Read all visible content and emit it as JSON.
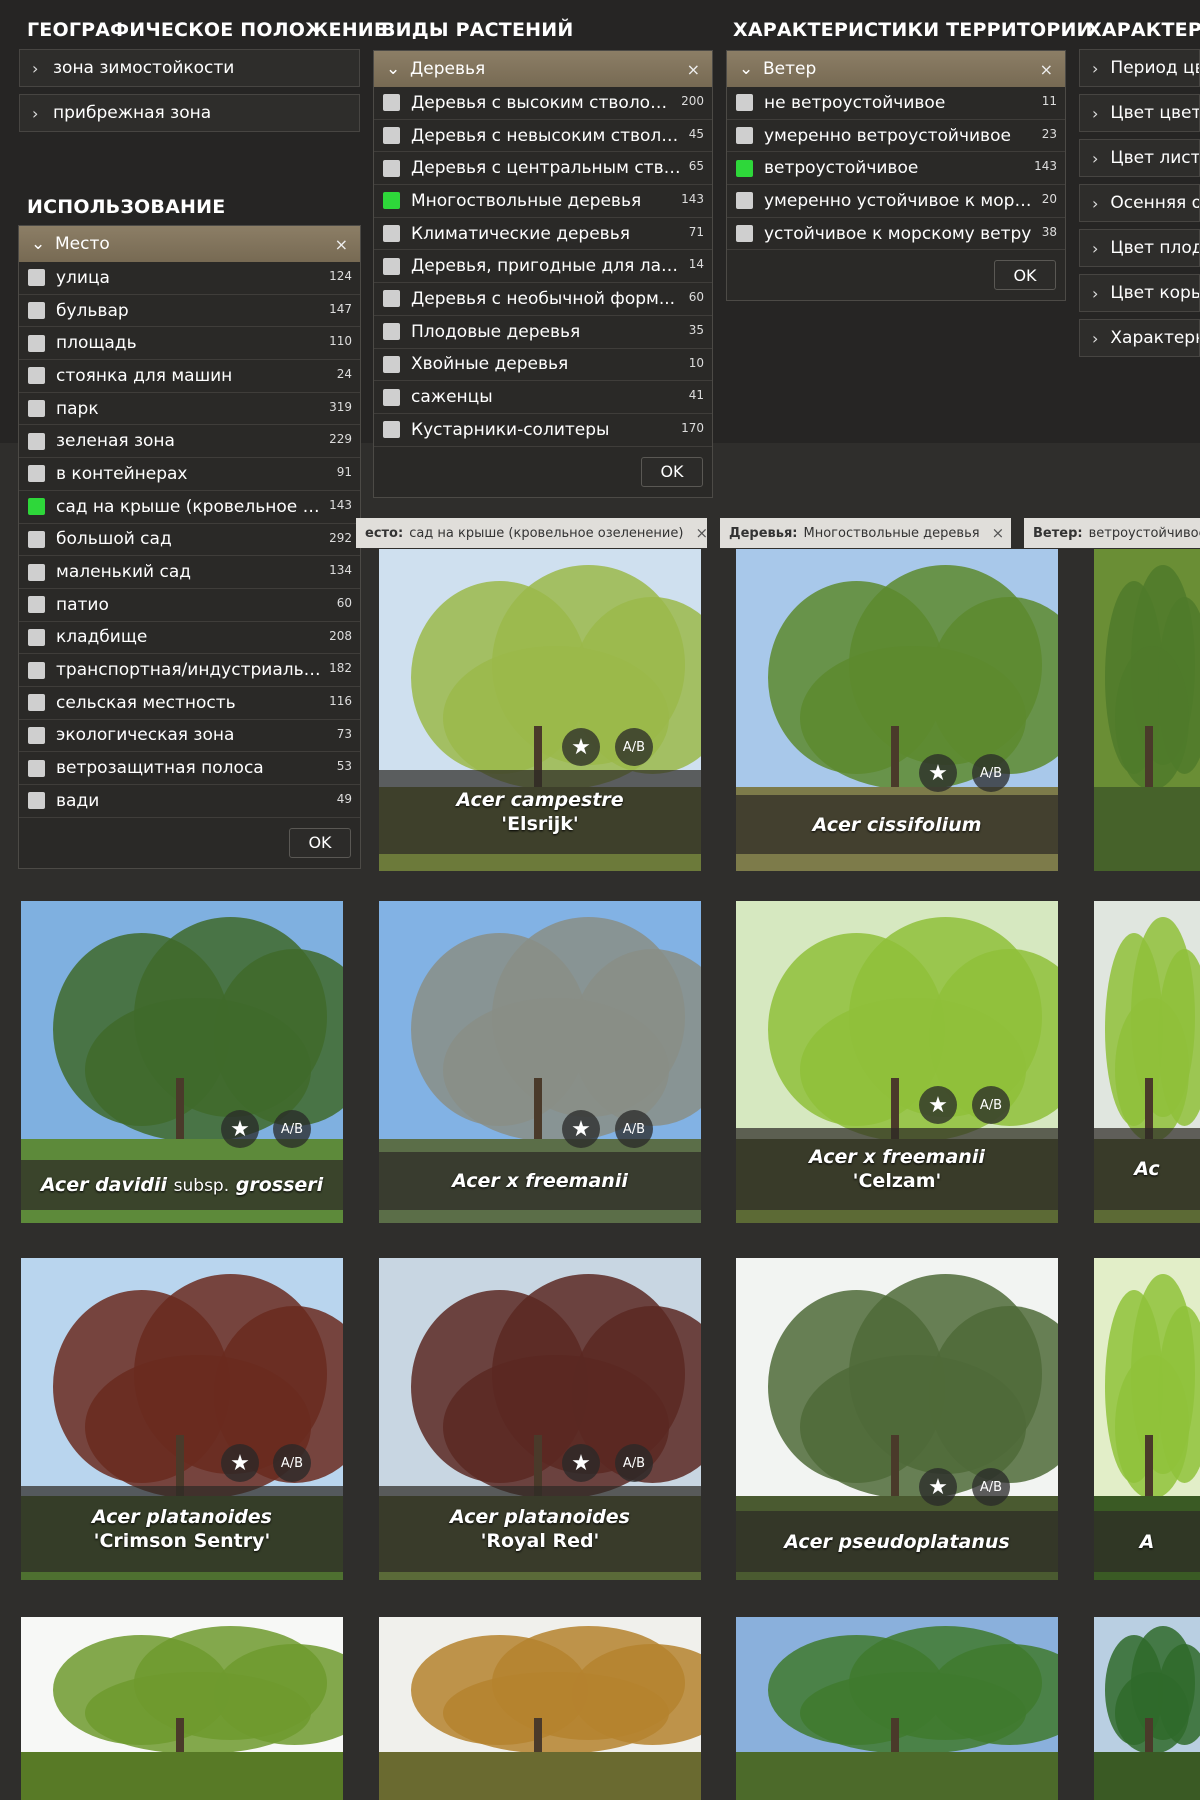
{
  "headings": {
    "geo": "ГЕОГРАФИЧЕСКОЕ ПОЛОЖЕНИЕ",
    "plants": "ВИДЫ РАСТЕНИЙ",
    "territory": "ХАРАКТЕРИСТИКИ ТЕРРИТОРИИ",
    "features": "ХАРАКТЕРИС",
    "usage": "ИСПОЛЬЗОВАНИЕ"
  },
  "geo_items": [
    "зона зимостойкости",
    "прибрежная зона"
  ],
  "feature_items": [
    "Период цв",
    "Цвет цвет",
    "Цвет лист",
    "Осенняя о",
    "Цвет плод",
    "Цвет коры",
    "Характерн"
  ],
  "place_panel": {
    "title": "Место",
    "ok": "OK",
    "rows": [
      {
        "label": "улица",
        "count": "124",
        "checked": false
      },
      {
        "label": "бульвар",
        "count": "147",
        "checked": false
      },
      {
        "label": "площадь",
        "count": "110",
        "checked": false
      },
      {
        "label": "стоянка для машин",
        "count": "24",
        "checked": false
      },
      {
        "label": "парк",
        "count": "319",
        "checked": false
      },
      {
        "label": "зеленая зона",
        "count": "229",
        "checked": false
      },
      {
        "label": "в контейнерах",
        "count": "91",
        "checked": false
      },
      {
        "label": "сад на крыше (кровельное о...",
        "count": "143",
        "checked": true
      },
      {
        "label": "большой сад",
        "count": "292",
        "checked": false
      },
      {
        "label": "маленький сад",
        "count": "134",
        "checked": false
      },
      {
        "label": "патио",
        "count": "60",
        "checked": false
      },
      {
        "label": "кладбище",
        "count": "208",
        "checked": false
      },
      {
        "label": "транспортная/индустриальн...",
        "count": "182",
        "checked": false
      },
      {
        "label": "сельская местность",
        "count": "116",
        "checked": false
      },
      {
        "label": "экологическая зона",
        "count": "73",
        "checked": false
      },
      {
        "label": "ветрозащитная полоса",
        "count": "53",
        "checked": false
      },
      {
        "label": "вади",
        "count": "49",
        "checked": false
      }
    ]
  },
  "trees_panel": {
    "title": "Деревья",
    "ok": "OK",
    "rows": [
      {
        "label": "Деревья с высоким стволом ...",
        "count": "200",
        "checked": false
      },
      {
        "label": "Деревья с невысоким стволо...",
        "count": "45",
        "checked": false
      },
      {
        "label": "Деревья с центральным ство...",
        "count": "65",
        "checked": false
      },
      {
        "label": "Многоствольные деревья",
        "count": "143",
        "checked": true
      },
      {
        "label": "Климатические деревья",
        "count": "71",
        "checked": false
      },
      {
        "label": "Деревья, пригодные для лаз...",
        "count": "14",
        "checked": false
      },
      {
        "label": "Деревья с необычной форм...",
        "count": "60",
        "checked": false
      },
      {
        "label": "Плодовые деревья",
        "count": "35",
        "checked": false
      },
      {
        "label": "Хвойные деревья",
        "count": "10",
        "checked": false
      },
      {
        "label": "саженцы",
        "count": "41",
        "checked": false
      },
      {
        "label": "Кустарники-солитеры",
        "count": "170",
        "checked": false
      }
    ]
  },
  "wind_panel": {
    "title": "Ветер",
    "ok": "OK",
    "rows": [
      {
        "label": "не ветроустойчивое",
        "count": "11",
        "checked": false
      },
      {
        "label": "умеренно ветроустойчивое",
        "count": "23",
        "checked": false
      },
      {
        "label": "ветроустойчивое",
        "count": "143",
        "checked": true
      },
      {
        "label": "умеренно устойчивое к морс...",
        "count": "20",
        "checked": false
      },
      {
        "label": "устойчивое к морскому ветру",
        "count": "38",
        "checked": false
      }
    ]
  },
  "chips": [
    {
      "key": "есто:",
      "value": "сад на крыше (кровельное озеленение)",
      "close": "×"
    },
    {
      "key": "Деревья:",
      "value": "Многоствольные деревья",
      "close": "×"
    },
    {
      "key": "Ветер:",
      "value": "ветроустойчивое",
      "close": ""
    }
  ],
  "cards": [
    {
      "genus": "Acer",
      "species": "campestre",
      "extra": "",
      "cultivar": "'Elsrijk'"
    },
    {
      "genus": "Acer",
      "species": "cissifolium",
      "extra": "",
      "cultivar": ""
    },
    {
      "genus": "",
      "species": "",
      "extra": "",
      "cultivar": ""
    },
    {
      "genus": "Acer",
      "species": "davidii",
      "extra": "subsp.",
      "cultivar": "grosseri"
    },
    {
      "genus": "Acer",
      "species": "x freemanii",
      "extra": "",
      "cultivar": ""
    },
    {
      "genus": "Acer",
      "species": "x freemanii",
      "extra": "",
      "cultivar": "'Celzam'"
    },
    {
      "genus": "Ac",
      "species": "",
      "extra": "",
      "cultivar": ""
    },
    {
      "genus": "Acer",
      "species": "platanoides",
      "extra": "",
      "cultivar": "'Crimson Sentry'"
    },
    {
      "genus": "Acer",
      "species": "platanoides",
      "extra": "",
      "cultivar": "'Royal Red'"
    },
    {
      "genus": "Acer",
      "species": "pseudoplatanus",
      "extra": "",
      "cultivar": ""
    },
    {
      "genus": "A",
      "species": "",
      "extra": "",
      "cultivar": ""
    }
  ],
  "icons": {
    "star": "star-icon",
    "ab": "compare-ab-icon",
    "chevron": "chevron-right-icon",
    "close": "close-icon"
  },
  "ab_label": "A/B",
  "colors": {
    "accent_checked": "#2ed73a",
    "panel_header": "#847760",
    "background": "#2f2e2c"
  }
}
